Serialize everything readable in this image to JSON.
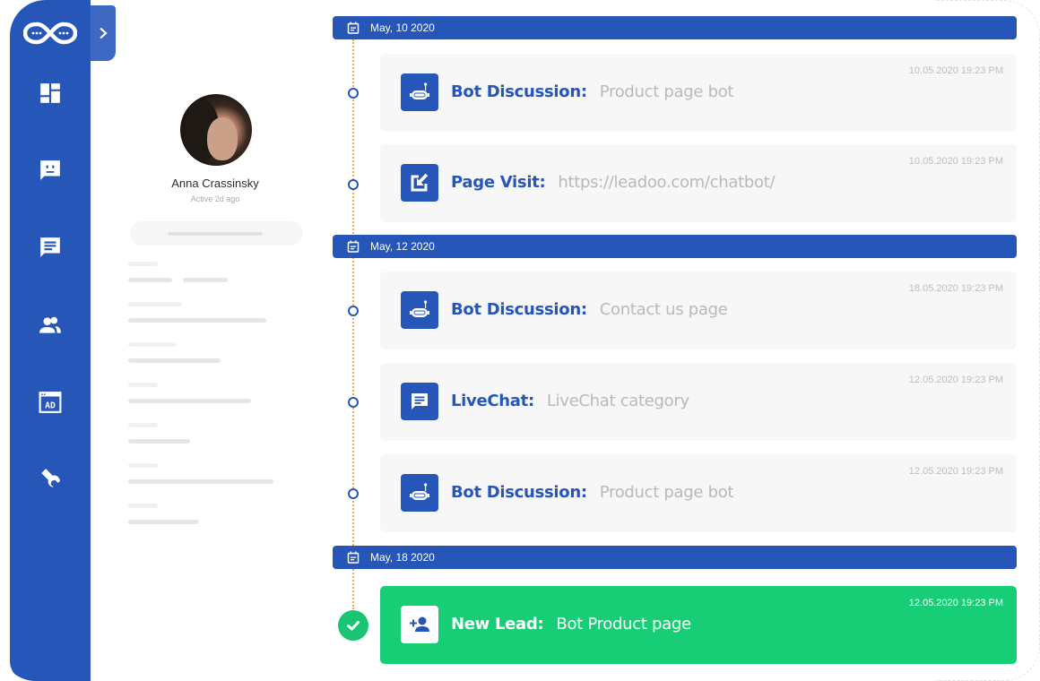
{
  "colors": {
    "brand_blue": "#2756b9",
    "lead_green": "#17cd75",
    "timeline_dots": "#f2a84a"
  },
  "sidebar": {
    "logo": "infinity-chat-logo",
    "toggle": "chevron-right-icon",
    "items": [
      {
        "name": "dashboard",
        "icon": "dashboard-icon"
      },
      {
        "name": "bots",
        "icon": "bot-chat-icon"
      },
      {
        "name": "livechat",
        "icon": "message-icon"
      },
      {
        "name": "contacts",
        "icon": "people-icon"
      },
      {
        "name": "ads",
        "icon": "ad-icon"
      },
      {
        "name": "settings",
        "icon": "wrench-icon"
      }
    ]
  },
  "profile": {
    "name": "Anna Crassinsky",
    "status": "Active 2d ago"
  },
  "timeline": {
    "groups": [
      {
        "date": "May, 10 2020",
        "events": [
          {
            "type": "Bot Discussion:",
            "detail": "Product page bot",
            "time": "10.05.2020 19:23 PM",
            "icon": "robot-icon"
          },
          {
            "type": "Page Visit:",
            "detail": "https://leadoo.com/chatbot/",
            "time": "10.05.2020 19:23 PM",
            "icon": "page-visit-icon"
          }
        ]
      },
      {
        "date": "May, 12 2020",
        "events": [
          {
            "type": "Bot Discussion:",
            "detail": "Contact us page",
            "time": "18.05.2020 19:23 PM",
            "icon": "robot-icon"
          },
          {
            "type": "LiveChat:",
            "detail": "LiveChat category",
            "time": "12.05.2020 19:23 PM",
            "icon": "message-icon"
          },
          {
            "type": "Bot Discussion:",
            "detail": "Product page bot",
            "time": "12.05.2020 19:23 PM",
            "icon": "robot-icon"
          }
        ]
      },
      {
        "date": "May, 18 2020",
        "events": [
          {
            "type": "New Lead:",
            "detail": "Bot Product page",
            "time": "12.05.2020 19:23 PM",
            "icon": "add-person-icon"
          }
        ]
      }
    ]
  }
}
